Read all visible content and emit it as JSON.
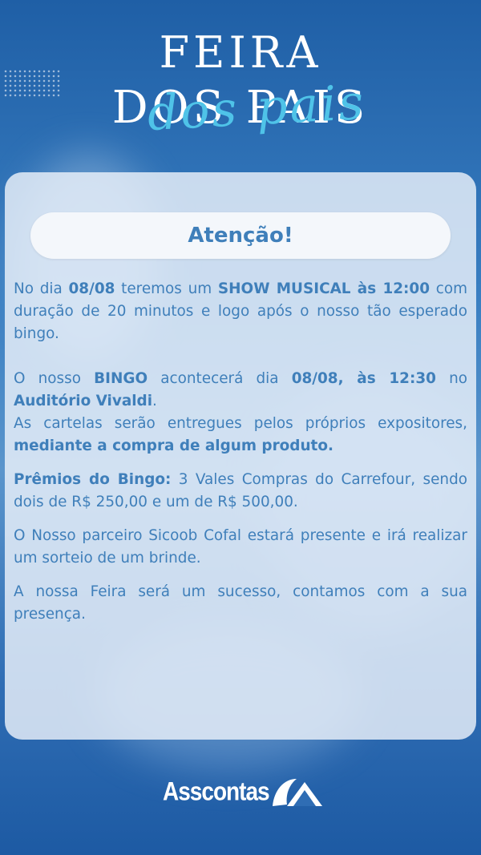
{
  "header": {
    "title_line1": "FEIRA",
    "title_line2": "DOS PAIS",
    "title_script": "dos pais"
  },
  "banner": {
    "label": "Atenção!"
  },
  "para1": {
    "t1": "No dia ",
    "b1": "08/08",
    "t2": " teremos um ",
    "b2": "SHOW MUSICAL às 12:00",
    "t3": " com duração de 20 minutos e logo após o nosso tão esperado bingo."
  },
  "para2": {
    "t1": "O nosso ",
    "b1": "BINGO",
    "t2": " acontecerá dia ",
    "b2": "08/08, às 12:30",
    "t3": " no ",
    "b3": "Auditório Vivaldi",
    "t4": "."
  },
  "para3": {
    "t1": "As cartelas serão entregues pelos próprios expositores, ",
    "b1": "mediante a compra de algum produto."
  },
  "para4": {
    "b1": "Prêmios do Bingo:",
    "t1": " 3 Vales Compras do Carrefour, sendo dois de R$ 250,00 e um de R$ 500,00."
  },
  "para5": {
    "t1": "O Nosso parceiro Sicoob Cofal estará presente e irá realizar um sorteio de um brinde."
  },
  "para6": {
    "t1": "A nossa Feira será um sucesso, contamos com a sua presença."
  },
  "footer": {
    "logo_text": "Asscontas",
    "logo_icon": "wave-triangle-icon"
  },
  "colors": {
    "accent": "#3f7fba",
    "script": "#4fc3e8",
    "background": "#2f6db4"
  }
}
